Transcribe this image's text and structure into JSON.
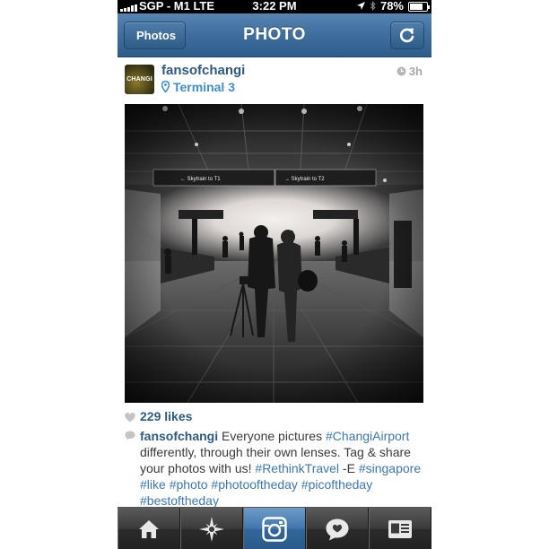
{
  "status_bar": {
    "carrier": "SGP - M1  LTE",
    "time": "3:22 PM",
    "battery": "78%",
    "battery_level": 0.78
  },
  "nav": {
    "back_label": "Photos",
    "title": "PHOTO",
    "refresh_icon": "refresh-icon"
  },
  "post": {
    "avatar_text": "CHANGI",
    "username": "fansofchangi",
    "location": "Terminal 3",
    "time_ago": "3h",
    "photo_signs": [
      "Skytrain to T1",
      "Skytrain to T2"
    ],
    "likes": "229 likes",
    "caption": {
      "user": "fansofchangi",
      "text_1": " Everyone pictures ",
      "tag_1": "#ChangiAirport",
      "text_2": " differently, through their own lenses. Tag & share your photos with us! ",
      "tag_2": "#RethinkTravel",
      "text_3": " -E ",
      "tag_3": "#singapore",
      "tag_4": "#like",
      "tag_5": "#photo",
      "tag_6": "#photooftheday",
      "tag_7": "#picoftheday",
      "tag_8": "#bestoftheday"
    }
  },
  "tab_bar": {
    "tabs": [
      {
        "icon": "home-icon",
        "active": false
      },
      {
        "icon": "explore-star-icon",
        "active": false
      },
      {
        "icon": "camera-icon",
        "active": true
      },
      {
        "icon": "activity-bubble-icon",
        "active": false
      },
      {
        "icon": "profile-card-icon",
        "active": false
      }
    ]
  },
  "colors": {
    "nav_blue": "#3f6e9c",
    "link_blue": "#2d5a82",
    "hashtag_blue": "#3a78b5",
    "location_blue": "#3d8fd0"
  }
}
